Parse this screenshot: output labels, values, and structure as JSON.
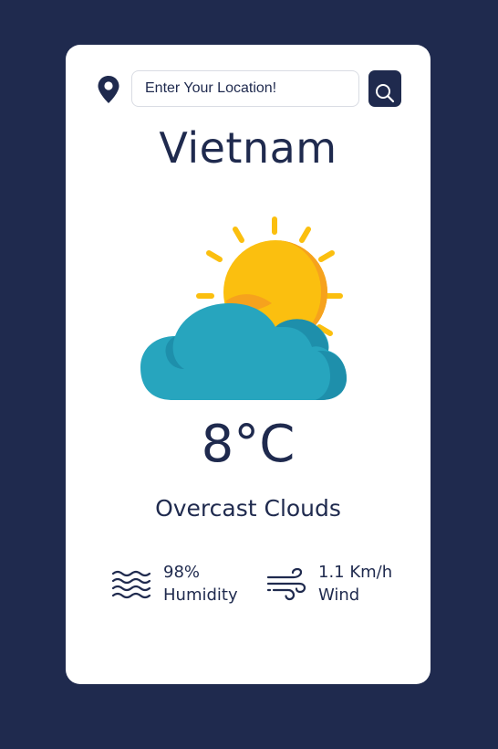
{
  "search": {
    "placeholder": "Enter Your Location!",
    "value": ""
  },
  "location": {
    "city": "Vietnam"
  },
  "weather": {
    "icon": "partly-cloudy-sun-icon",
    "temperature": "8°C",
    "description": "Overcast Clouds"
  },
  "stats": {
    "humidity": {
      "value": "98%",
      "label": "Humidity",
      "icon": "waves-icon"
    },
    "wind": {
      "value": "1.1 Km/h",
      "label": "Wind",
      "icon": "wind-icon"
    }
  },
  "colors": {
    "background": "#1f2a4e",
    "card": "#ffffff",
    "text": "#1f2a4e",
    "sun": "#fbbf0f",
    "cloud": "#27a5be"
  }
}
